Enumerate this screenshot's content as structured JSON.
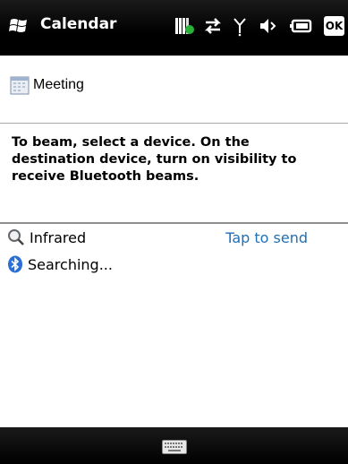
{
  "titlebar": {
    "title": "Calendar",
    "icons": [
      "windows-start-icon",
      "signal-strength-icon",
      "data-connection-icon",
      "antenna-icon",
      "volume-icon",
      "battery-icon"
    ],
    "ok_label": "OK"
  },
  "item": {
    "name": "Meeting",
    "icon": "calendar-icon"
  },
  "instructions": "To beam, select a device. On the destination device, turn on visibility to receive Bluetooth beams.",
  "devices": [
    {
      "label": "Infrared",
      "icon": "search-icon",
      "action": "Tap to send"
    },
    {
      "label": "Searching...",
      "icon": "bluetooth-icon"
    }
  ],
  "bottombar": {
    "icon": "keyboard-icon"
  },
  "colors": {
    "bar": "#000000",
    "link": "#1f6fb8",
    "bluetooth": "#2a6fd6"
  }
}
